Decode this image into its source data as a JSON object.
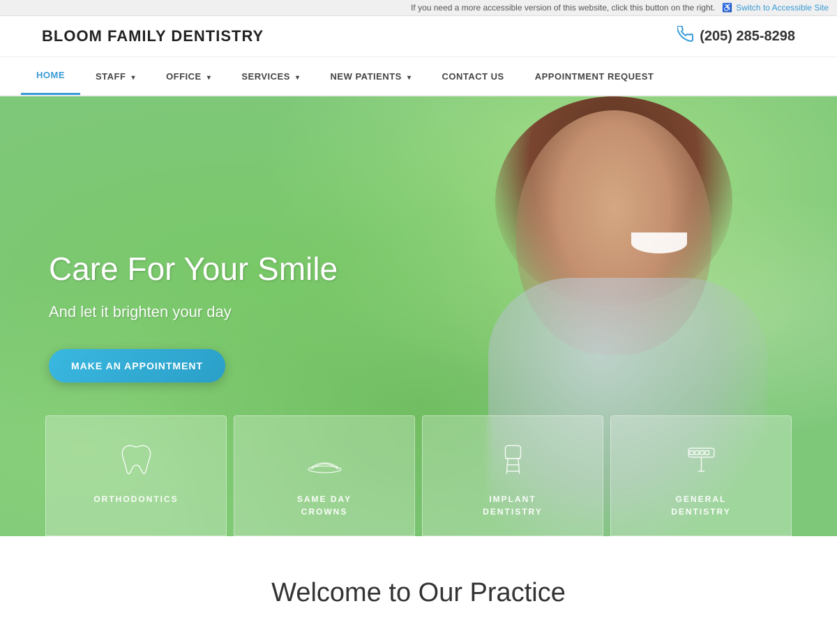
{
  "accessibility": {
    "info_text": "If you need a more accessible version of this website, click this button on the right.",
    "link_text": "Switch to Accessible Site",
    "icon": "♿"
  },
  "header": {
    "logo": "BLOOM FAMILY DENTISTRY",
    "phone": "(205) 285-8298",
    "phone_icon": "📞"
  },
  "nav": {
    "items": [
      {
        "label": "HOME",
        "active": true,
        "has_dropdown": false
      },
      {
        "label": "STAFF",
        "active": false,
        "has_dropdown": true
      },
      {
        "label": "OFFICE",
        "active": false,
        "has_dropdown": true
      },
      {
        "label": "SERVICES",
        "active": false,
        "has_dropdown": true
      },
      {
        "label": "NEW PATIENTS",
        "active": false,
        "has_dropdown": true
      },
      {
        "label": "CONTACT US",
        "active": false,
        "has_dropdown": false
      },
      {
        "label": "APPOINTMENT REQUEST",
        "active": false,
        "has_dropdown": false
      }
    ]
  },
  "hero": {
    "title": "Care For Your Smile",
    "subtitle": "And let it brighten your day",
    "cta_button": "MAKE AN APPOINTMENT"
  },
  "services": [
    {
      "id": "orthodontics",
      "label": "ORTHODONTICS",
      "icon": "tooth"
    },
    {
      "id": "same-day-crowns",
      "label": "SAME DAY\nCROWNS",
      "icon": "crown"
    },
    {
      "id": "implant-dentistry",
      "label": "IMPLANT\nDENTISTRY",
      "icon": "implant"
    },
    {
      "id": "general-dentistry",
      "label": "GENERAL\nDENTISTRY",
      "icon": "general"
    }
  ],
  "welcome": {
    "title": "Welcome to Our Practice"
  },
  "colors": {
    "accent_blue": "#3ab8e0",
    "nav_active": "#3a9bd5",
    "hero_green": "#7ec87a"
  }
}
